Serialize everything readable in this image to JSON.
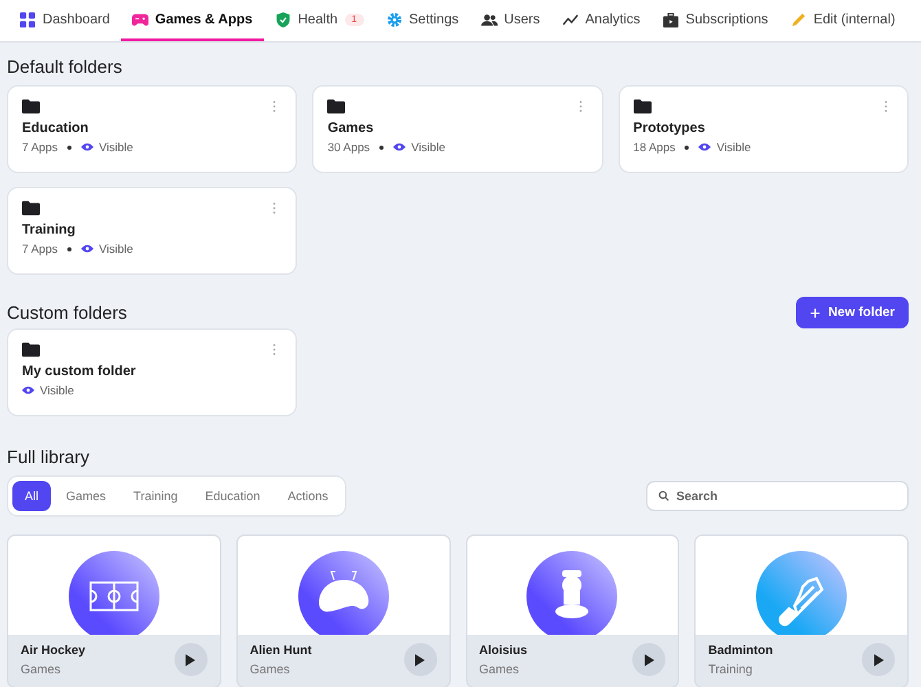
{
  "tabs": [
    {
      "label": "Dashboard",
      "selected": false
    },
    {
      "label": "Games & Apps",
      "selected": true
    },
    {
      "label": "Health",
      "selected": false,
      "badge": "1"
    },
    {
      "label": "Settings",
      "selected": false
    },
    {
      "label": "Users",
      "selected": false
    },
    {
      "label": "Analytics",
      "selected": false
    },
    {
      "label": "Subscriptions",
      "selected": false
    },
    {
      "label": "Edit (internal)",
      "selected": false
    }
  ],
  "default_folders": {
    "title": "Default folders",
    "folders": [
      {
        "name": "Education",
        "apps": "7 Apps",
        "visibility": "Visible"
      },
      {
        "name": "Games",
        "apps": "30 Apps",
        "visibility": "Visible"
      },
      {
        "name": "Prototypes",
        "apps": "18 Apps",
        "visibility": "Visible"
      },
      {
        "name": "Training",
        "apps": "7 Apps",
        "visibility": "Visible"
      }
    ]
  },
  "custom_folders": {
    "title": "Custom folders",
    "new_button": "New folder",
    "folders": [
      {
        "name": "My custom folder",
        "visibility": "Visible"
      }
    ]
  },
  "library": {
    "title": "Full library",
    "filters": [
      {
        "label": "All",
        "selected": true
      },
      {
        "label": "Games",
        "selected": false
      },
      {
        "label": "Training",
        "selected": false
      },
      {
        "label": "Education",
        "selected": false
      },
      {
        "label": "Actions",
        "selected": false
      }
    ],
    "search": {
      "placeholder": "Search"
    },
    "apps": [
      {
        "name": "Air Hockey",
        "category": "Games",
        "kind": "rink",
        "color": "#5b4bff"
      },
      {
        "name": "Alien Hunt",
        "category": "Games",
        "kind": "alien",
        "color": "#5b4bff"
      },
      {
        "name": "Aloisius",
        "category": "Games",
        "kind": "figure",
        "color": "#5b4bff"
      },
      {
        "name": "Badminton",
        "category": "Training",
        "kind": "shuttlecock",
        "color": "#1aa8f5"
      }
    ]
  }
}
